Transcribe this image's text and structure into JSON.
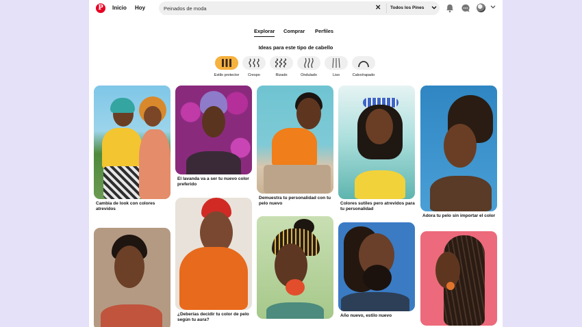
{
  "header": {
    "logo": "P",
    "nav": [
      "Inicio",
      "Hoy"
    ],
    "search_value": "Peinados de moda",
    "search_clear": "✕",
    "scope": "Todos los Pines",
    "chevron": "⌄"
  },
  "tabs": [
    "Explorar",
    "Comprar",
    "Perfiles"
  ],
  "ideas_title": "Ideas para este tipo de cabello",
  "hair_types": [
    {
      "label": "Estilo protector",
      "icon": "protective-style-icon",
      "active": true
    },
    {
      "label": "Crespo",
      "icon": "coily-icon",
      "active": false
    },
    {
      "label": "Rizado",
      "icon": "curly-icon",
      "active": false
    },
    {
      "label": "Ondulado",
      "icon": "wavy-icon",
      "active": false
    },
    {
      "label": "Liso",
      "icon": "straight-icon",
      "active": false
    },
    {
      "label": "Calvo/rapado",
      "icon": "bald-icon",
      "active": false
    }
  ],
  "pins": {
    "col1": [
      {
        "caption": "Cambia de look con colores atrevidos"
      },
      {
        "caption": ""
      }
    ],
    "col2": [
      {
        "caption": "El lavanda va a ser tu nuevo color preferido"
      },
      {
        "caption": "¿Deberías decidir tu color de pelo según tu aura?"
      }
    ],
    "col3": [
      {
        "caption": "Demuestra tu personalidad con tu pelo nuevo"
      },
      {
        "caption": ""
      }
    ],
    "col4": [
      {
        "caption": "Colores sutiles pero atrevidos para tu personalidad"
      },
      {
        "caption": "Año nuevo, estilo nuevo"
      }
    ],
    "col5": [
      {
        "caption": "Adora tu pelo sin importar el color"
      },
      {
        "caption": ""
      }
    ]
  },
  "colors": {
    "brand": "#e60023",
    "chip_active": "#f6b13e",
    "chip": "#efefef",
    "background": "#e4e1f8"
  }
}
